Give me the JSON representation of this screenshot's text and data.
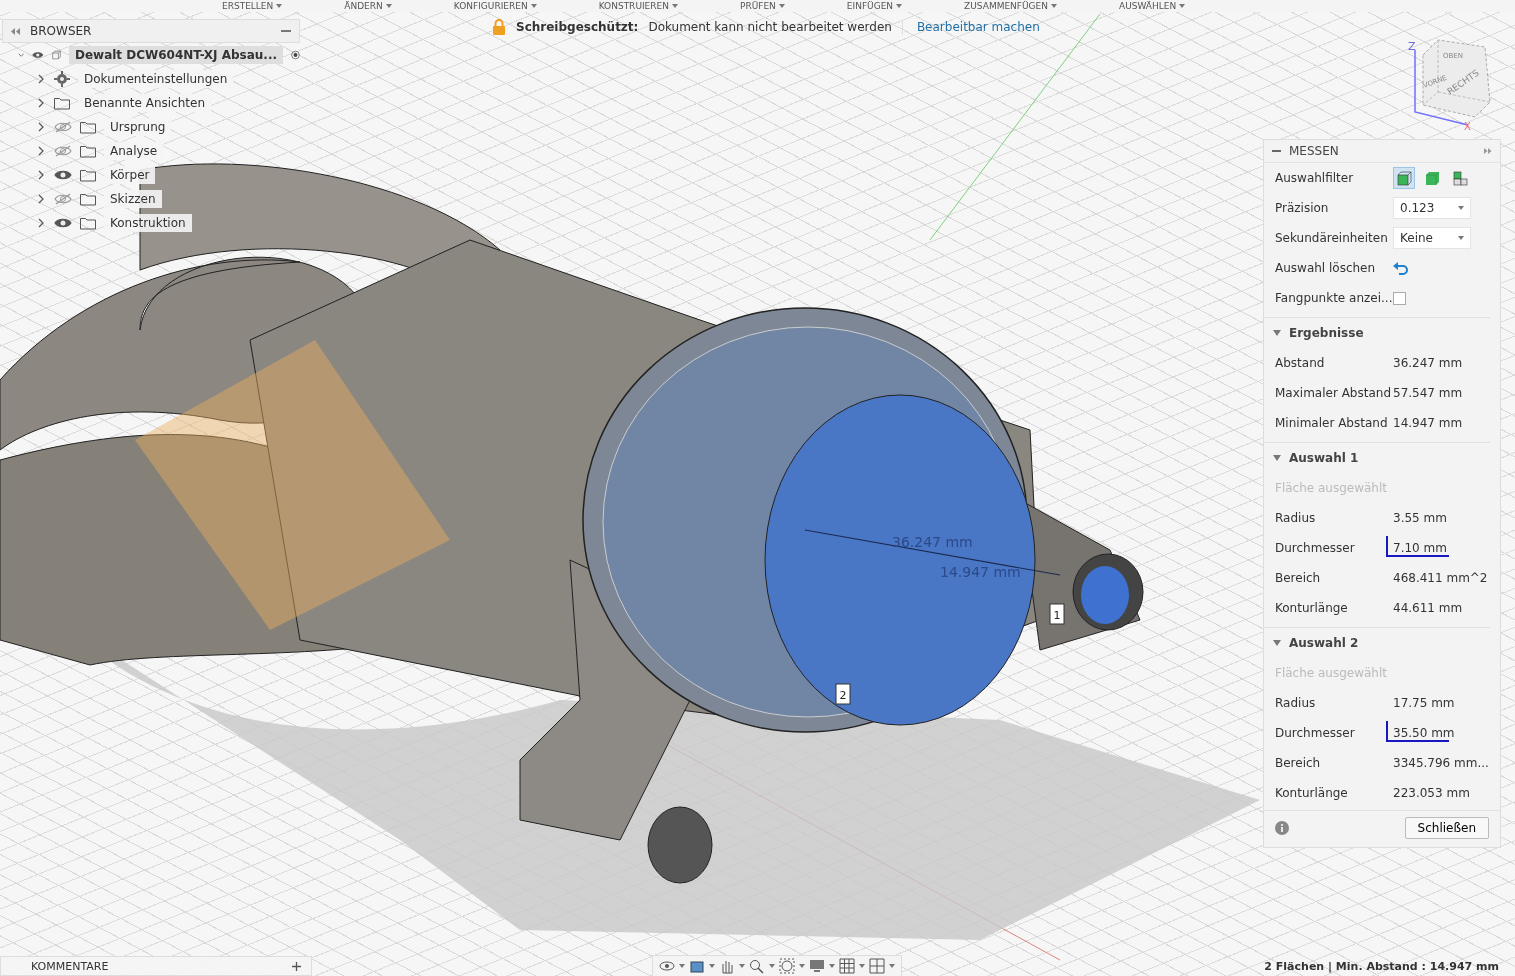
{
  "toolbar": {
    "menus": [
      "ERSTELLEN",
      "ÄNDERN",
      "KONFIGURIEREN",
      "KONSTRUIEREN",
      "PRÜFEN",
      "EINFÜGEN",
      "ZUSAMMENFÜGEN",
      "AUSWÄHLEN"
    ]
  },
  "readonly_bar": {
    "title": "Schreibgeschützt:",
    "message": "Dokument kann nicht bearbeitet werden",
    "link": "Bearbeitbar machen"
  },
  "browser": {
    "title": "BROWSER",
    "root": {
      "label": "Dewalt DCW604NT-XJ Absau...",
      "visible": true,
      "expanded": true,
      "active": true,
      "selected": true,
      "children": [
        {
          "label": "Dokumenteinstellungen",
          "kind": "settings",
          "expanded": false,
          "selected": false
        },
        {
          "label": "Benannte Ansichten",
          "kind": "folder",
          "expanded": false,
          "selected": false
        },
        {
          "label": "Ursprung",
          "kind": "folder",
          "visible": false,
          "expanded": false,
          "selected": false
        },
        {
          "label": "Analyse",
          "kind": "folder",
          "visible": false,
          "expanded": false,
          "selected": false
        },
        {
          "label": "Körper",
          "kind": "folder",
          "visible": true,
          "expanded": false,
          "selected": false
        },
        {
          "label": "Skizzen",
          "kind": "folder",
          "visible": false,
          "expanded": false,
          "selected": false
        },
        {
          "label": "Konstruktion",
          "kind": "folder",
          "visible": true,
          "expanded": false,
          "selected": false
        }
      ]
    }
  },
  "viewport": {
    "dimension_labels": [
      "36.247 mm",
      "14.947 mm"
    ],
    "markers": [
      "1",
      "2"
    ],
    "view_cube": {
      "faces": [
        "OBEN",
        "VORNE",
        "RECHTS"
      ],
      "axes": [
        "Z",
        "X"
      ]
    }
  },
  "measure_panel": {
    "title": "MESSEN",
    "filter": {
      "label": "Auswahlfilter",
      "options": [
        {
          "selected": true
        },
        {
          "selected": false
        },
        {
          "selected": false
        }
      ]
    },
    "precision": {
      "label": "Präzision",
      "value": "0.123"
    },
    "secondary_units": {
      "label": "Sekundäreinheiten",
      "value": "Keine"
    },
    "clear_selection": {
      "label": "Auswahl löschen"
    },
    "snap_points": {
      "label": "Fangpunkte anzei...",
      "checked": false
    },
    "sections": [
      {
        "title": "Ergebnisse",
        "expanded": true,
        "rows": [
          {
            "label": "Abstand",
            "value": "36.247 mm",
            "underlined": false
          },
          {
            "label": "Maximaler Abstand",
            "value": "57.547 mm",
            "underlined": false
          },
          {
            "label": "Minimaler Abstand",
            "value": "14.947 mm",
            "underlined": false
          }
        ]
      },
      {
        "title": "Auswahl 1",
        "expanded": true,
        "subtitle": "Fläche ausgewählt",
        "rows": [
          {
            "label": "Radius",
            "value": "3.55 mm",
            "underlined": false
          },
          {
            "label": "Durchmesser",
            "value": "7.10 mm",
            "underlined": true
          },
          {
            "label": "Bereich",
            "value": "468.411 mm^2",
            "underlined": false
          },
          {
            "label": "Konturlänge",
            "value": "44.611 mm",
            "underlined": false
          }
        ]
      },
      {
        "title": "Auswahl 2",
        "expanded": true,
        "subtitle": "Fläche ausgewählt",
        "rows": [
          {
            "label": "Radius",
            "value": "17.75 mm",
            "underlined": false
          },
          {
            "label": "Durchmesser",
            "value": "35.50 mm",
            "underlined": true
          },
          {
            "label": "Bereich",
            "value": "3345.796 mm...",
            "underlined": false
          },
          {
            "label": "Konturlänge",
            "value": "223.053 mm",
            "underlined": false
          }
        ]
      }
    ],
    "close_button": "Schließen"
  },
  "comments_panel": {
    "title": "KOMMENTARE"
  },
  "status_text": "2 Flächen | Min. Abstand : 14.947 mm"
}
